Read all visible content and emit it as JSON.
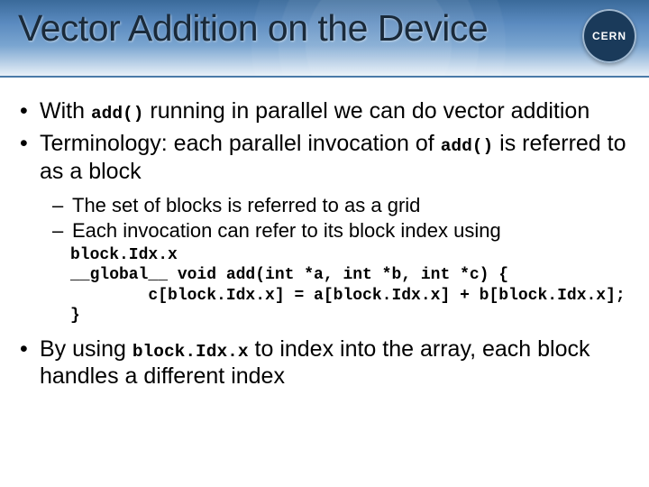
{
  "header": {
    "title": "Vector Addition on the Device",
    "logo_text": "CERN"
  },
  "bullets": {
    "b1_part1": "With ",
    "b1_code": "add()",
    "b1_part2": " running in parallel we can do vector addition",
    "b2_part1": "Terminology: each parallel invocation of ",
    "b2_code": "add()",
    "b2_part2": " is referred to as a ",
    "b2_block": "block",
    "b3_part1": "By using ",
    "b3_code": "block.Idx.x",
    "b3_part2": " to index into the array, each block handles a different index"
  },
  "sub": {
    "s1_part1": "The set of blocks is referred to as a ",
    "s1_grid": "grid",
    "s2_part1": "Each invocation can refer to its block index using"
  },
  "code": {
    "line1": "block.Idx.x",
    "line2": "__global__ void add(int *a, int *b, int *c) {",
    "line3": "        c[block.Idx.x] = a[block.Idx.x] + b[block.Idx.x];",
    "line4": "}"
  }
}
